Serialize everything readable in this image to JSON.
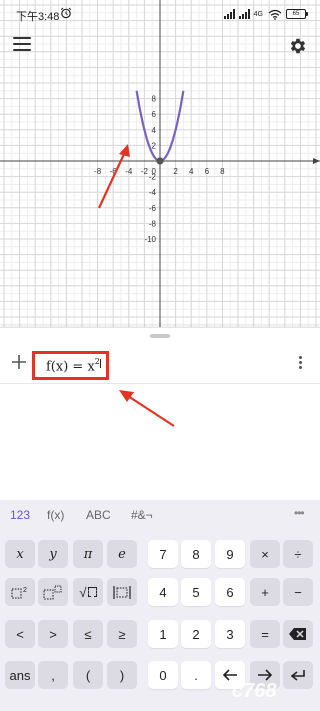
{
  "status_bar": {
    "time": "下午3:48",
    "network": "4G",
    "battery": "65"
  },
  "graph": {
    "x_ticks": [
      "-8",
      "-6",
      "-4",
      "-2",
      "2",
      "4",
      "6",
      "8"
    ],
    "y_ticks": [
      "8",
      "6",
      "4",
      "2",
      "-2",
      "-4",
      "-6",
      "-8",
      "-10"
    ],
    "origin_label": "0",
    "curve_color": "#7a62c4"
  },
  "chart_data": {
    "type": "line",
    "series": [
      {
        "x": [
          -3,
          -2.5,
          -2,
          -1.5,
          -1,
          -0.5,
          0,
          0.5,
          1,
          1.5,
          2,
          2.5,
          3
        ],
        "y": [
          9,
          6.25,
          4,
          2.25,
          1,
          0.25,
          0,
          0.25,
          1,
          2.25,
          4,
          6.25,
          9
        ]
      }
    ],
    "xlim": [
      -10.5,
      10.5
    ],
    "ylim": [
      -10.5,
      10.5
    ],
    "grid": true
  },
  "algebra": {
    "expression_text": "f(x) = x",
    "expression_exp": "2"
  },
  "keyboard": {
    "tabs": [
      {
        "label": "123",
        "active": true
      },
      {
        "label": "f(x)",
        "active": false
      },
      {
        "label": "ABC",
        "active": false
      },
      {
        "label": "#&¬",
        "active": false
      }
    ],
    "more_label": "•••",
    "rows": [
      [
        {
          "label": "x",
          "style": "serif",
          "name": "x-key"
        },
        {
          "label": "y",
          "style": "serif",
          "name": "y-key"
        },
        {
          "label": "π",
          "style": "serif",
          "name": "pi-key"
        },
        {
          "label": "e",
          "style": "serif",
          "name": "e-key"
        },
        {
          "label": "7",
          "name": "digit-7-key"
        },
        {
          "label": "8",
          "name": "digit-8-key"
        },
        {
          "label": "9",
          "name": "digit-9-key"
        },
        {
          "label": "×",
          "name": "multiply-key"
        },
        {
          "label": "÷",
          "name": "divide-key"
        }
      ],
      [
        {
          "label": "",
          "icon": "square",
          "name": "square-key"
        },
        {
          "label": "",
          "icon": "power",
          "name": "power-key"
        },
        {
          "label": "√",
          "name": "sqrt-key"
        },
        {
          "label": "",
          "icon": "abs",
          "name": "abs-key"
        },
        {
          "label": "4",
          "name": "digit-4-key"
        },
        {
          "label": "5",
          "name": "digit-5-key"
        },
        {
          "label": "6",
          "name": "digit-6-key"
        },
        {
          "label": "+",
          "name": "plus-key"
        },
        {
          "label": "−",
          "name": "minus-key"
        }
      ],
      [
        {
          "label": "<",
          "name": "less-than-key"
        },
        {
          "label": ">",
          "name": "greater-than-key"
        },
        {
          "label": "≤",
          "name": "less-equal-key"
        },
        {
          "label": "≥",
          "name": "greater-equal-key"
        },
        {
          "label": "1",
          "name": "digit-1-key"
        },
        {
          "label": "2",
          "name": "digit-2-key"
        },
        {
          "label": "3",
          "name": "digit-3-key"
        },
        {
          "label": "=",
          "name": "equals-key"
        },
        {
          "label": "",
          "icon": "backspace",
          "name": "backspace-key"
        }
      ],
      [
        {
          "label": "ans",
          "name": "ans-key"
        },
        {
          "label": ",",
          "name": "comma-key"
        },
        {
          "label": "(",
          "name": "open-paren-key"
        },
        {
          "label": ")",
          "name": "close-paren-key"
        },
        {
          "label": "0",
          "name": "digit-0-key"
        },
        {
          "label": ".",
          "name": "decimal-key"
        },
        {
          "label": "",
          "icon": "arrow-left",
          "name": "cursor-left-key"
        },
        {
          "label": "",
          "icon": "arrow-right",
          "name": "cursor-right-key"
        },
        {
          "label": "",
          "icon": "enter",
          "name": "enter-key"
        }
      ]
    ]
  },
  "colors": {
    "accent": "#6557d2",
    "highlight": "#e53323",
    "key_gray": "#dcdbe3"
  }
}
